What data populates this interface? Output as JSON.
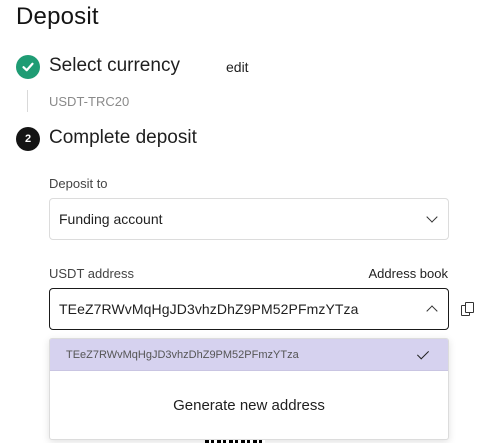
{
  "page": {
    "title": "Deposit"
  },
  "step1": {
    "label": "Select currency",
    "edit_label": "edit",
    "value": "USDT-TRC20"
  },
  "step2": {
    "number": "2",
    "label": "Complete deposit"
  },
  "deposit_to": {
    "label": "Deposit to",
    "selected": "Funding account"
  },
  "usdt_address": {
    "label": "USDT address",
    "address_book_label": "Address book",
    "selected": "TEeZ7RWvMqHgJD3vhzDhZ9PM52PFmzYTza"
  },
  "dropdown": {
    "options": [
      {
        "label": "TEeZ7RWvMqHgJD3vhzDhZ9PM52PFmzYTza",
        "selected": true
      }
    ],
    "generate_label": "Generate new address"
  },
  "colors": {
    "success": "#1f9c74",
    "selected_option_bg": "#d6d2ef",
    "step_active": "#141414"
  },
  "icons": [
    "check-circle-icon",
    "chevron-down-icon",
    "chevron-up-icon",
    "copy-icon",
    "checkmark-icon",
    "qr-code-icon"
  ]
}
